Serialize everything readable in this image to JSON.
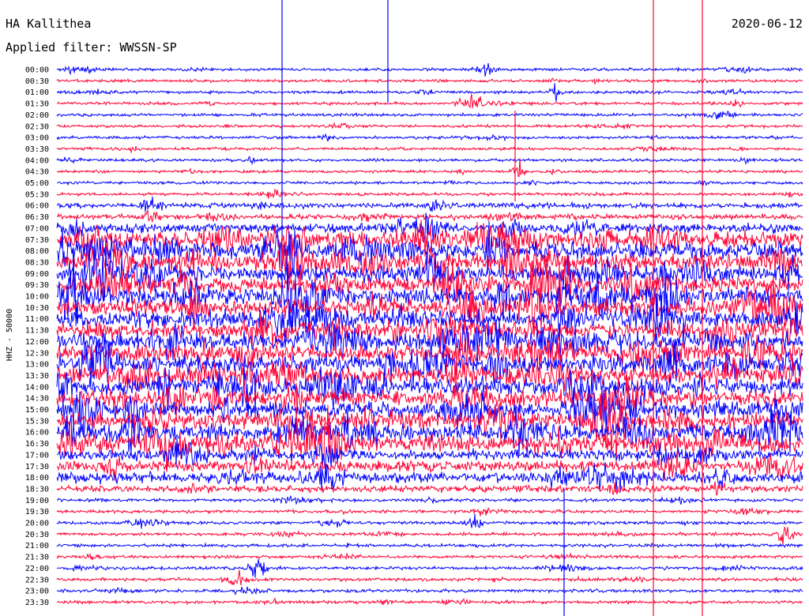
{
  "header": {
    "station": "HA Kallithea",
    "filter": "Applied filter: WWSSN-SP",
    "date": "2020-06-12"
  },
  "chart_data": {
    "type": "line",
    "title": "HA Kallithea",
    "subtitle": "Applied filter: WWSSN-SP",
    "date": "2020-06-12",
    "ylabel": "HHZ - 50000",
    "row_labels": [
      "00:00",
      "00:30",
      "01:00",
      "01:30",
      "02:00",
      "02:30",
      "03:00",
      "03:30",
      "04:00",
      "04:30",
      "05:00",
      "05:30",
      "06:00",
      "06:30",
      "07:00",
      "07:30",
      "08:00",
      "08:30",
      "09:00",
      "09:30",
      "10:00",
      "10:30",
      "11:00",
      "11:30",
      "12:00",
      "12:30",
      "13:00",
      "13:30",
      "14:00",
      "14:30",
      "15:00",
      "15:30",
      "16:00",
      "16:30",
      "17:00",
      "17:30",
      "18:00",
      "18:30",
      "19:00",
      "19:30",
      "20:00",
      "20:30",
      "21:00",
      "21:30",
      "22:00",
      "22:30",
      "23:00",
      "23:30"
    ],
    "row_colors": [
      "#0000ff",
      "#ff0033"
    ],
    "grid": false,
    "legend": "none"
  }
}
